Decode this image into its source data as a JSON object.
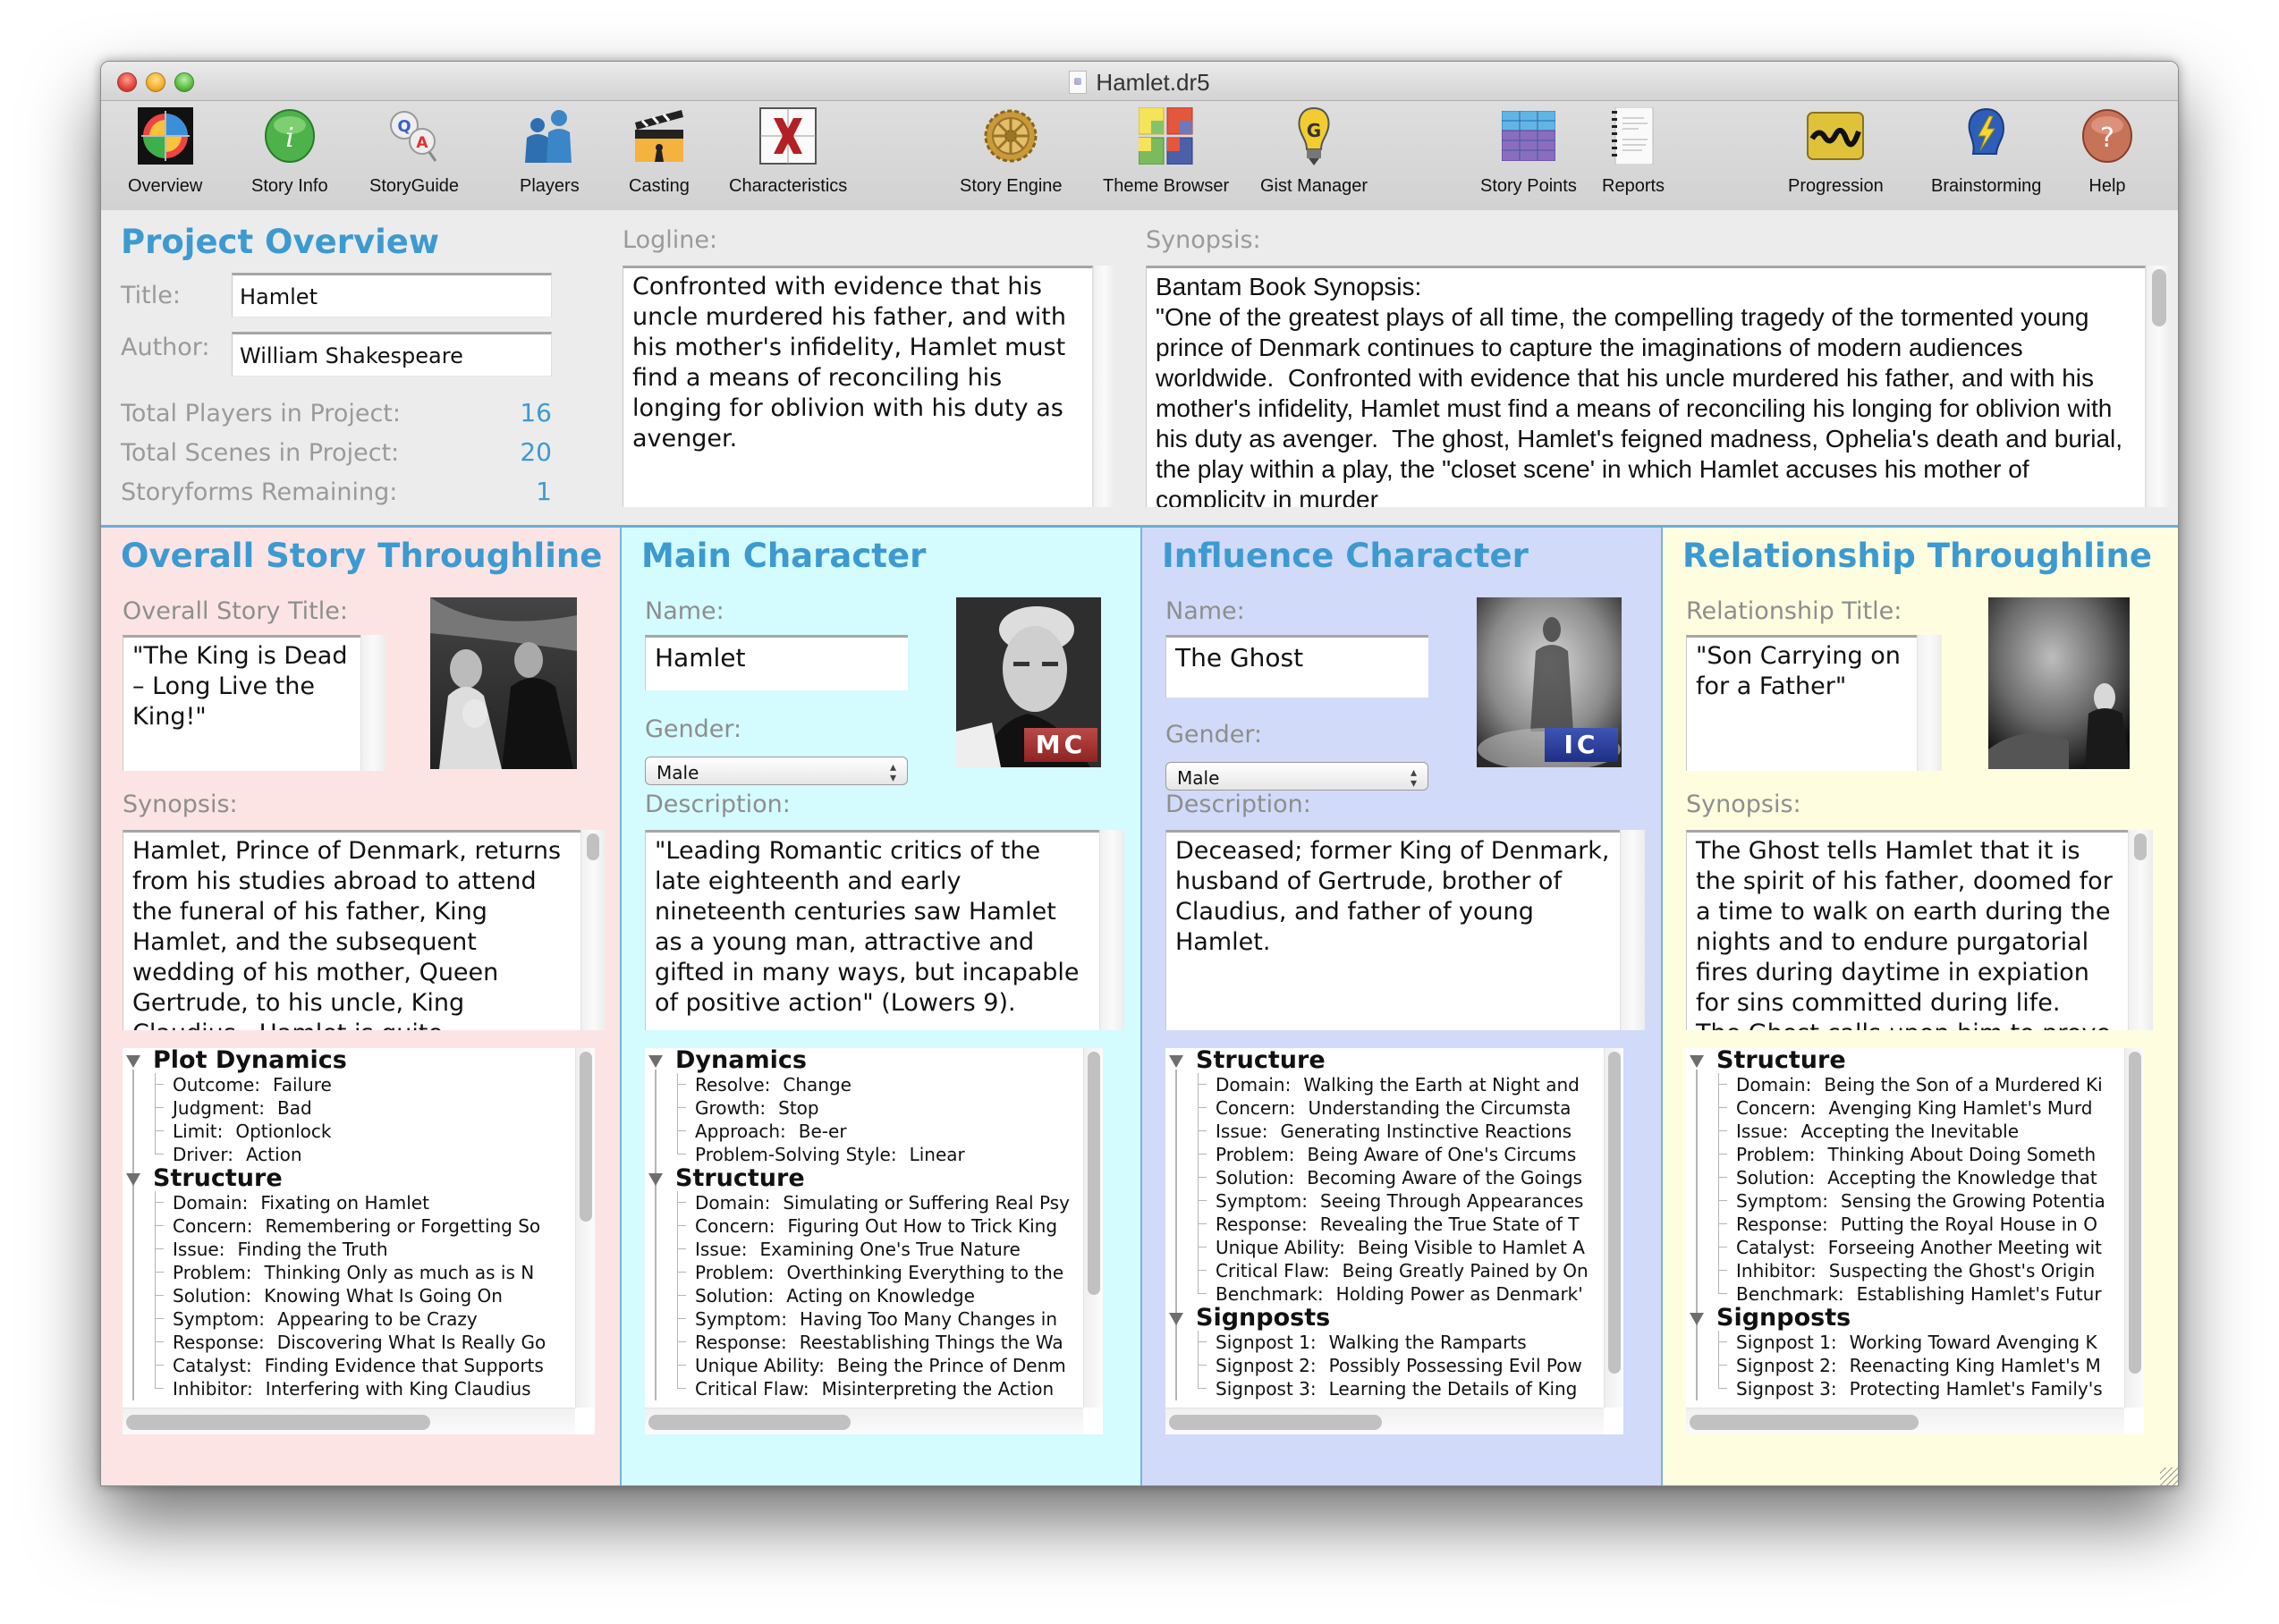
{
  "window": {
    "title": "Hamlet.dr5"
  },
  "toolbar": [
    {
      "label": "Overview",
      "icon": "overview-icon"
    },
    {
      "label": "Story Info",
      "icon": "info-icon"
    },
    {
      "label": "StoryGuide",
      "icon": "storyguide-qa-icon"
    },
    {
      "label": "Players",
      "icon": "players-icon"
    },
    {
      "label": "Casting",
      "icon": "clapperboard-icon"
    },
    {
      "label": "Characteristics",
      "icon": "characteristics-icon"
    },
    {
      "label": "Story Engine",
      "icon": "gear-icon"
    },
    {
      "label": "Theme Browser",
      "icon": "theme-grid-icon"
    },
    {
      "label": "Gist Manager",
      "icon": "lightbulb-icon"
    },
    {
      "label": "Story Points",
      "icon": "story-points-icon"
    },
    {
      "label": "Reports",
      "icon": "report-icon"
    },
    {
      "label": "Progression",
      "icon": "progression-wave-icon"
    },
    {
      "label": "Brainstorming",
      "icon": "brainstorm-icon"
    },
    {
      "label": "Help",
      "icon": "help-icon"
    }
  ],
  "overview": {
    "heading": "Project Overview",
    "title_label": "Title:",
    "title_value": "Hamlet",
    "author_label": "Author:",
    "author_value": "William Shakespeare",
    "stats": [
      {
        "label": "Total Players in Project:",
        "value": "16"
      },
      {
        "label": "Total Scenes in Project:",
        "value": "20"
      },
      {
        "label": "Storyforms Remaining:",
        "value": "1"
      }
    ],
    "logline_label": "Logline:",
    "logline": "Confronted with evidence that his uncle murdered his father, and with his mother's infidelity, Hamlet must find a means of reconciling his longing for oblivion with his duty as avenger.",
    "synopsis_label": "Synopsis:",
    "synopsis": "Bantam Book Synopsis:\n\"One of the greatest plays of all time, the compelling tragedy of the tormented young prince of Denmark continues to capture the imaginations of modern audiences worldwide.  Confronted with evidence that his uncle murdered his father, and with his mother's infidelity, Hamlet must find a means of reconciling his longing for oblivion with his duty as avenger.  The ghost, Hamlet's feigned madness, Ophelia's death and burial, the play within a play, the \"closet scene' in which Hamlet accuses his mother of complicity in murder"
  },
  "panels": {
    "overall": {
      "heading": "Overall Story Throughline",
      "bg": "#fde4e4",
      "title_label": "Overall Story Title:",
      "title_value": "\"The King is Dead – Long Live the King!\"",
      "synopsis_label": "Synopsis:",
      "synopsis": "Hamlet, Prince of Denmark, returns from his studies abroad to attend the funeral of his father, King Hamlet, and the subsequent wedding of his mother, Queen Gertrude, to his uncle, King Claudius.  Hamlet is quite",
      "tree": [
        {
          "title": "Plot Dynamics",
          "rows": [
            {
              "key": "Outcome:",
              "value": "Failure"
            },
            {
              "key": "Judgment:",
              "value": "Bad"
            },
            {
              "key": "Limit:",
              "value": "Optionlock"
            },
            {
              "key": "Driver:",
              "value": "Action"
            }
          ]
        },
        {
          "title": "Structure",
          "rows": [
            {
              "key": "Domain:",
              "value": "Fixating on Hamlet"
            },
            {
              "key": "Concern:",
              "value": "Remembering or Forgetting So"
            },
            {
              "key": "Issue:",
              "value": "Finding the Truth"
            },
            {
              "key": "Problem:",
              "value": "Thinking Only as much as is N"
            },
            {
              "key": "Solution:",
              "value": "Knowing What Is Going On"
            },
            {
              "key": "Symptom:",
              "value": "Appearing to be Crazy"
            },
            {
              "key": "Response:",
              "value": "Discovering What Is Really Go"
            },
            {
              "key": "Catalyst:",
              "value": "Finding Evidence that Supports"
            },
            {
              "key": "Inhibitor:",
              "value": "Interfering with King Claudius"
            }
          ]
        }
      ]
    },
    "main_character": {
      "heading": "Main Character",
      "bg": "#d4fbfd",
      "name_label": "Name:",
      "name_value": "Hamlet",
      "gender_label": "Gender:",
      "gender_value": "Male",
      "badge": "MC",
      "badge_color": "#a8302d",
      "description_label": "Description:",
      "description": "\"Leading Romantic critics of the late eighteenth and early nineteenth centuries saw Hamlet as a young man, attractive and gifted in many ways, but incapable of positive action\" (Lowers 9).",
      "tree": [
        {
          "title": "Dynamics",
          "rows": [
            {
              "key": "Resolve:",
              "value": "Change"
            },
            {
              "key": "Growth:",
              "value": "Stop"
            },
            {
              "key": "Approach:",
              "value": "Be-er"
            },
            {
              "key": "Problem-Solving Style:",
              "value": "Linear"
            }
          ]
        },
        {
          "title": "Structure",
          "rows": [
            {
              "key": "Domain:",
              "value": "Simulating or Suffering Real Psy"
            },
            {
              "key": "Concern:",
              "value": "Figuring Out How to Trick King"
            },
            {
              "key": "Issue:",
              "value": "Examining One's True Nature"
            },
            {
              "key": "Problem:",
              "value": "Overthinking Everything to the"
            },
            {
              "key": "Solution:",
              "value": "Acting on Knowledge"
            },
            {
              "key": "Symptom:",
              "value": "Having Too Many Changes in"
            },
            {
              "key": "Response:",
              "value": "Reestablishing Things the Wa"
            },
            {
              "key": "Unique Ability:",
              "value": "Being the Prince of Denm"
            },
            {
              "key": "Critical Flaw:",
              "value": "Misinterpreting the Action"
            }
          ]
        }
      ]
    },
    "influence_character": {
      "heading": "Influence Character",
      "bg": "#d2daf9",
      "name_label": "Name:",
      "name_value": "The Ghost",
      "gender_label": "Gender:",
      "gender_value": "Male",
      "badge": "IC",
      "badge_color": "#2a3d9e",
      "description_label": "Description:",
      "description": "Deceased; former King of Denmark, husband of Gertrude, brother of Claudius, and father of young Hamlet.",
      "tree": [
        {
          "title": "Structure",
          "rows": [
            {
              "key": "Domain:",
              "value": "Walking the Earth at Night and"
            },
            {
              "key": "Concern:",
              "value": "Understanding the Circumsta"
            },
            {
              "key": "Issue:",
              "value": "Generating Instinctive Reactions"
            },
            {
              "key": "Problem:",
              "value": "Being Aware of One's Circums"
            },
            {
              "key": "Solution:",
              "value": "Becoming Aware of the Goings"
            },
            {
              "key": "Symptom:",
              "value": "Seeing Through Appearances"
            },
            {
              "key": "Response:",
              "value": "Revealing the True State of T"
            },
            {
              "key": "Unique Ability:",
              "value": "Being Visible to Hamlet A"
            },
            {
              "key": "Critical Flaw:",
              "value": "Being Greatly Pained by On"
            },
            {
              "key": "Benchmark:",
              "value": "Holding Power as Denmark'"
            }
          ]
        },
        {
          "title": "Signposts",
          "rows": [
            {
              "key": "Signpost 1:",
              "value": "Walking the Ramparts"
            },
            {
              "key": "Signpost 2:",
              "value": "Possibly Possessing Evil Pow"
            },
            {
              "key": "Signpost 3:",
              "value": "Learning the Details of King"
            }
          ]
        }
      ]
    },
    "relationship": {
      "heading": "Relationship Throughline",
      "bg": "#fefde0",
      "title_label": "Relationship Title:",
      "title_value": "\"Son Carrying on for a Father\"",
      "synopsis_label": "Synopsis:",
      "synopsis": "The Ghost tells Hamlet that it is the spirit of his father, doomed for a time to walk on earth during the nights and to endure purgatorial fires during daytime in expiation for sins committed during life.  The Ghost calls upon him to prove",
      "tree": [
        {
          "title": "Structure",
          "rows": [
            {
              "key": "Domain:",
              "value": "Being the Son of a Murdered Ki"
            },
            {
              "key": "Concern:",
              "value": "Avenging King Hamlet's Murd"
            },
            {
              "key": "Issue:",
              "value": "Accepting the Inevitable"
            },
            {
              "key": "Problem:",
              "value": "Thinking About Doing Someth"
            },
            {
              "key": "Solution:",
              "value": "Accepting the Knowledge that"
            },
            {
              "key": "Symptom:",
              "value": "Sensing the Growing Potentia"
            },
            {
              "key": "Response:",
              "value": "Putting the Royal House in O"
            },
            {
              "key": "Catalyst:",
              "value": "Forseeing Another Meeting wit"
            },
            {
              "key": "Inhibitor:",
              "value": "Suspecting the Ghost's Origin"
            },
            {
              "key": "Benchmark:",
              "value": "Establishing Hamlet's Futur"
            }
          ]
        },
        {
          "title": "Signposts",
          "rows": [
            {
              "key": "Signpost 1:",
              "value": "Working Toward Avenging K"
            },
            {
              "key": "Signpost 2:",
              "value": "Reenacting King Hamlet's M"
            },
            {
              "key": "Signpost 3:",
              "value": "Protecting Hamlet's Family's"
            }
          ]
        }
      ]
    }
  },
  "colors": {
    "accent_heading": "#3c9ad1",
    "label_grey": "#9a9a9a",
    "divider": "#6aaed6"
  }
}
